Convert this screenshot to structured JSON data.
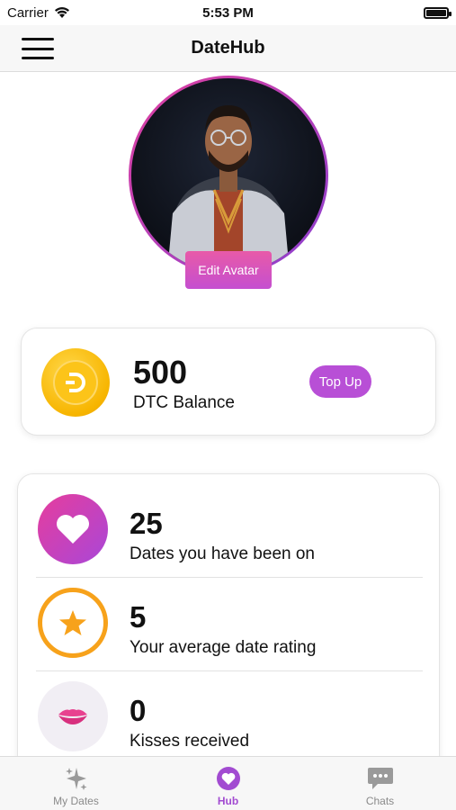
{
  "status_bar": {
    "carrier": "Carrier",
    "time": "5:53 PM"
  },
  "nav": {
    "title": "DateHub"
  },
  "avatar": {
    "edit_label": "Edit Avatar"
  },
  "balance": {
    "value": "500",
    "label": "DTC Balance",
    "topup_label": "Top Up"
  },
  "stats": [
    {
      "value": "25",
      "label": "Dates you have been on",
      "icon": "heart-icon"
    },
    {
      "value": "5",
      "label": "Your average date rating",
      "icon": "star-icon"
    },
    {
      "value": "0",
      "label": "Kisses received",
      "icon": "lips-icon"
    }
  ],
  "tabs": [
    {
      "label": "My Dates",
      "icon": "sparkles-icon",
      "active": false
    },
    {
      "label": "Hub",
      "icon": "heart-icon",
      "active": true
    },
    {
      "label": "Chats",
      "icon": "chat-icon",
      "active": false
    }
  ],
  "colors": {
    "accent": "#a24bd1",
    "pink": "#e63d9d",
    "gold": "#f7b500",
    "star_orange": "#f7a21b"
  }
}
